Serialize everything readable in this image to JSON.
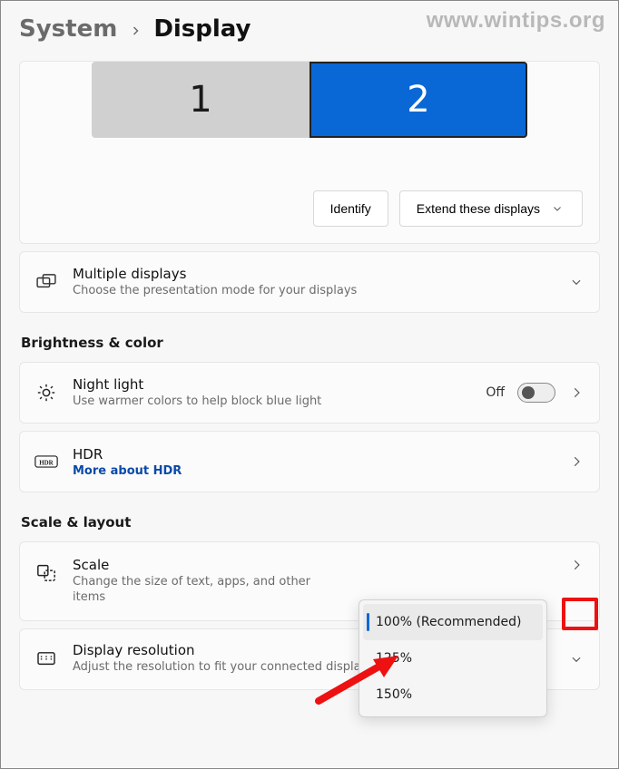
{
  "watermark": "www.wintips.org",
  "breadcrumb": {
    "root": "System",
    "current": "Display"
  },
  "monitors": {
    "one": "1",
    "two": "2"
  },
  "panel": {
    "identify": "Identify",
    "extend": "Extend these displays"
  },
  "multiple_displays": {
    "title": "Multiple displays",
    "sub": "Choose the presentation mode for your displays"
  },
  "section_brightness": "Brightness & color",
  "night_light": {
    "title": "Night light",
    "sub": "Use warmer colors to help block blue light",
    "state": "Off"
  },
  "hdr": {
    "title": "HDR",
    "link": "More about HDR"
  },
  "section_scale": "Scale & layout",
  "scale": {
    "title": "Scale",
    "sub": "Change the size of text, apps, and other items",
    "options": [
      "100% (Recommended)",
      "125%",
      "150%"
    ],
    "selected": "100% (Recommended)"
  },
  "display_resolution": {
    "title": "Display resolution",
    "sub": "Adjust the resolution to fit your connected displa"
  }
}
